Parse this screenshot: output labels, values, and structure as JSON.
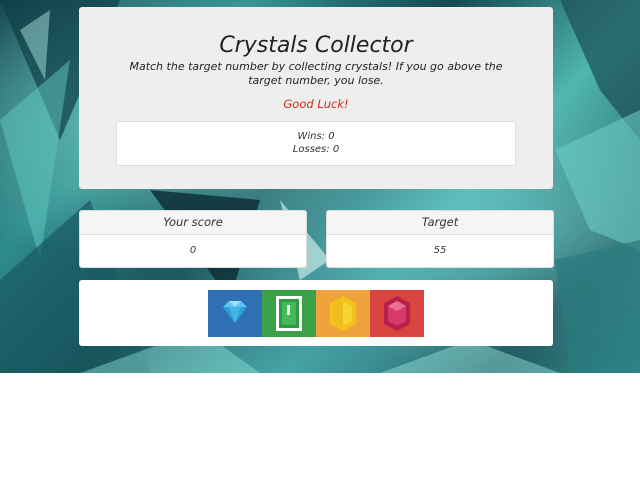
{
  "header": {
    "title": "Crystals Collector",
    "instructions": "Match the target number by collecting crystals! If you go above the target number, you lose.",
    "good_luck": "Good Luck!"
  },
  "stats": {
    "wins_text": "Wins: 0",
    "losses_text": "Losses: 0"
  },
  "score_card": {
    "label": "Your score",
    "value": "0"
  },
  "target_card": {
    "label": "Target",
    "value": "55"
  },
  "crystals": [
    {
      "icon": "blue-diamond-icon",
      "color": "#2f6fb3"
    },
    {
      "icon": "green-emerald-icon",
      "color": "#3aa148"
    },
    {
      "icon": "yellow-topaz-icon",
      "color": "#f0a23c"
    },
    {
      "icon": "red-ruby-icon",
      "color": "#d8453f"
    }
  ],
  "colors": {
    "good_luck": "#d6281b",
    "panel_bg": "#eeeeee"
  }
}
